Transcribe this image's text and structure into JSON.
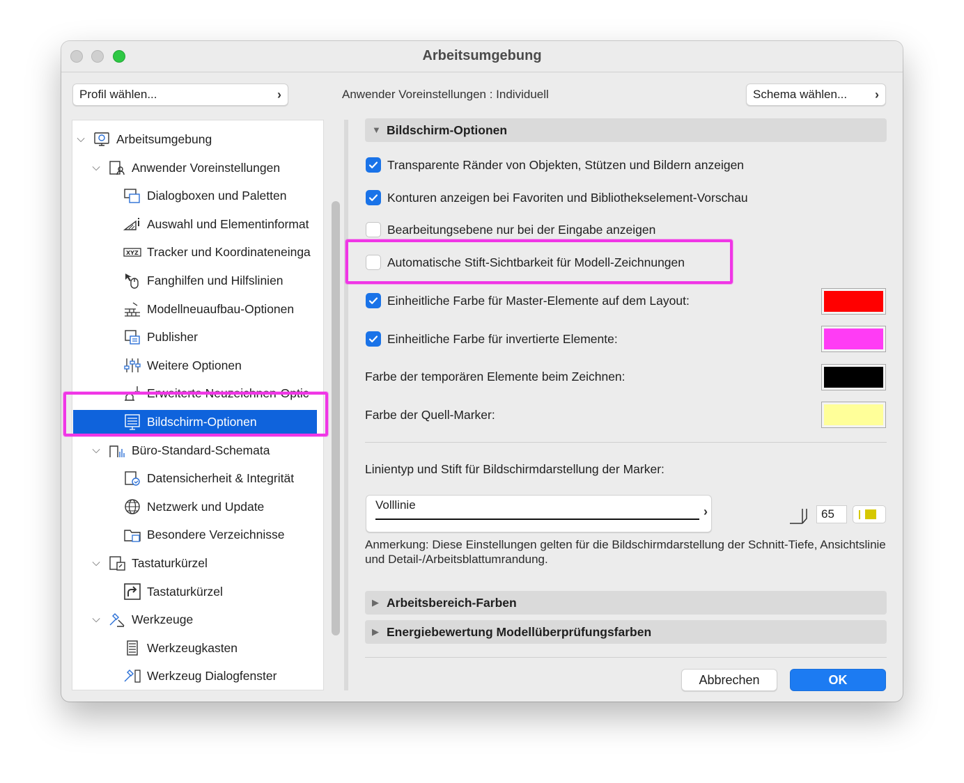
{
  "window": {
    "title": "Arbeitsumgebung"
  },
  "toolbar": {
    "profile_button": "Profil wählen...",
    "user_pref_label": "Anwender Voreinstellungen :",
    "user_pref_value": "Individuell",
    "schema_button": "Schema wählen..."
  },
  "tree": {
    "items": [
      {
        "label": "Arbeitsumgebung",
        "icon": "settings-screen-icon",
        "level": 0,
        "expanded": true
      },
      {
        "label": "Anwender Voreinstellungen",
        "icon": "user-preferences-icon",
        "level": 1,
        "expanded": true
      },
      {
        "label": "Dialogboxen und Paletten",
        "icon": "dialog-palette-icon",
        "level": 2
      },
      {
        "label": "Auswahl und Elementinformat",
        "icon": "selection-info-icon",
        "level": 2
      },
      {
        "label": "Tracker und Koordinateneinga",
        "icon": "xyz-tracker-icon",
        "level": 2
      },
      {
        "label": "Fanghilfen und Hilfslinien",
        "icon": "snap-mouse-icon",
        "level": 2
      },
      {
        "label": "Modellneuaufbau-Optionen",
        "icon": "rebuild-bricks-icon",
        "level": 2
      },
      {
        "label": "Publisher",
        "icon": "publisher-icon",
        "level": 2
      },
      {
        "label": "Weitere Optionen",
        "icon": "sliders-icon",
        "level": 2
      },
      {
        "label": "Erweiterte Neuzeichnen-Optic",
        "icon": "redraw-icon",
        "level": 2
      },
      {
        "label": "Bildschirm-Optionen",
        "icon": "display-options-icon",
        "level": 2,
        "selected": true
      },
      {
        "label": "Büro-Standard-Schemata",
        "icon": "office-schemes-icon",
        "level": 1,
        "expanded": true
      },
      {
        "label": "Datensicherheit & Integrität",
        "icon": "data-safety-icon",
        "level": 2
      },
      {
        "label": "Netzwerk und Update",
        "icon": "globe-icon",
        "level": 2
      },
      {
        "label": "Besondere Verzeichnisse",
        "icon": "folder-icon",
        "level": 2
      },
      {
        "label": "Tastaturkürzel",
        "icon": "keyboard-shortcuts-icon",
        "level": 1,
        "expanded": true
      },
      {
        "label": "Tastaturkürzel",
        "icon": "shortcut-arrow-icon",
        "level": 2
      },
      {
        "label": "Werkzeuge",
        "icon": "tools-icon",
        "level": 1,
        "expanded": true
      },
      {
        "label": "Werkzeugkasten",
        "icon": "toolbox-icon",
        "level": 2
      },
      {
        "label": "Werkzeug Dialogfenster",
        "icon": "tool-dialog-icon",
        "level": 2
      }
    ]
  },
  "display_options": {
    "header": "Bildschirm-Optionen",
    "checkboxes": [
      {
        "label": "Transparente Ränder von Objekten, Stützen und Bildern anzeigen",
        "checked": true
      },
      {
        "label": "Konturen anzeigen bei Favoriten und Bibliothekselement-Vorschau",
        "checked": true
      },
      {
        "label": "Bearbeitungsebene nur bei der Eingabe anzeigen",
        "checked": false
      },
      {
        "label": "Automatische Stift-Sichtbarkeit für Modell-Zeichnungen",
        "checked": false
      },
      {
        "label": "Einheitliche Farbe für Master-Elemente auf dem Layout:",
        "checked": true,
        "color": "#ff0000"
      },
      {
        "label": "Einheitliche Farbe für invertierte Elemente:",
        "checked": true,
        "color": "#ff3cf5"
      }
    ],
    "color_rows": [
      {
        "label": "Farbe der temporären Elemente beim Zeichnen:",
        "color": "#000000"
      },
      {
        "label": "Farbe der Quell-Marker:",
        "color": "#ffff99"
      }
    ],
    "marker_label": "Linientyp und Stift für Bildschirmdarstellung der Marker:",
    "line_type": "Volllinie",
    "pen_number": "65",
    "pen_color": "#d6c800",
    "note": "Anmerkung: Diese Einstellungen gelten für die Bildschirmdarstellung der Schnitt-Tiefe, Ansichtslinie und Detail-/Arbeitsblattumrandung."
  },
  "collapsed_sections": [
    {
      "label": "Arbeitsbereich-Farben"
    },
    {
      "label": "Energiebewertung Modellüberprüfungsfarben"
    }
  ],
  "buttons": {
    "cancel": "Abbrechen",
    "ok": "OK"
  },
  "highlight_color": "#f036e6"
}
